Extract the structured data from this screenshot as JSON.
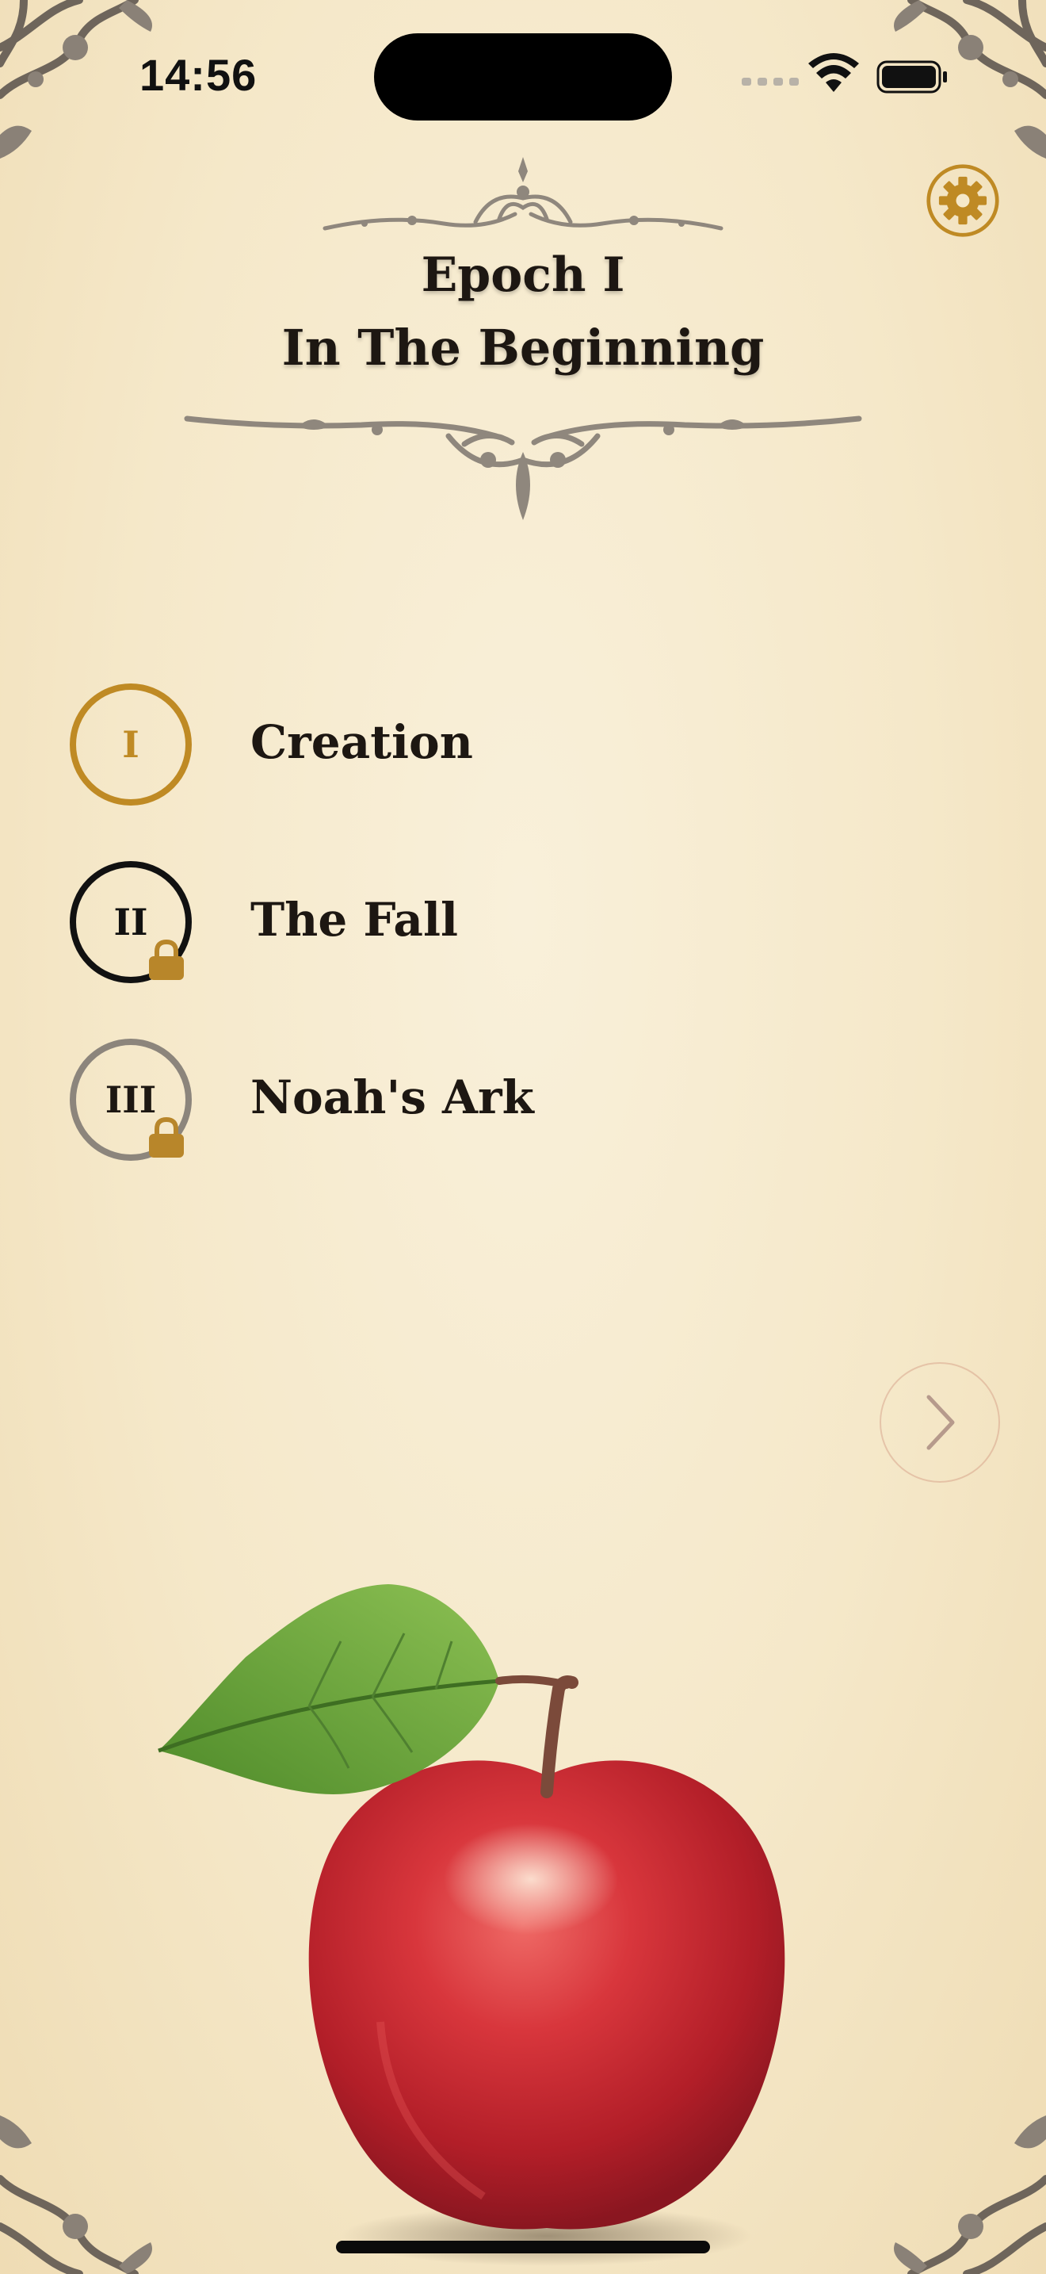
{
  "status_bar": {
    "time": "14:56"
  },
  "header": {
    "epoch_label": "Epoch I",
    "epoch_title": "In The Beginning"
  },
  "chapters": [
    {
      "numeral": "I",
      "title": "Creation",
      "state": "active"
    },
    {
      "numeral": "II",
      "title": "The Fall",
      "state": "locked"
    },
    {
      "numeral": "III",
      "title": "Noah's Ark",
      "state": "locked"
    }
  ],
  "icons": {
    "settings": "gear-icon",
    "next": "chevron-right-icon",
    "lock": "lock-icon"
  },
  "colors": {
    "background": "#f5e8c9",
    "accent_gold": "#bf8a24",
    "text": "#1d1712",
    "locked_ring": "#8c857c"
  }
}
